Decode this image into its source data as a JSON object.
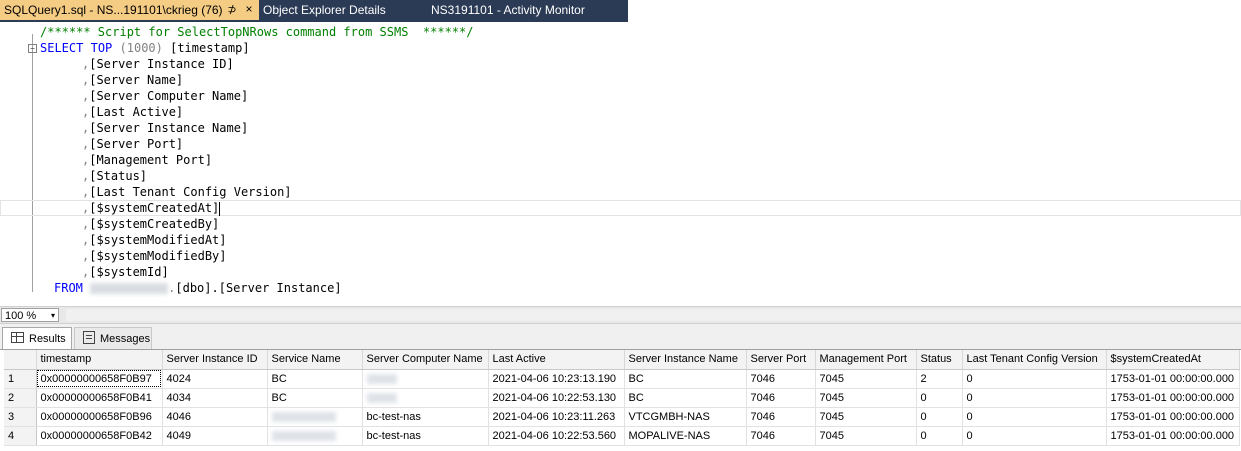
{
  "tabs": [
    {
      "label": "SQLQuery1.sql - NS...191101\\ckrieg (76)",
      "active": true
    },
    {
      "label": "Object Explorer Details",
      "active": false
    },
    {
      "label": "NS3191101 - Activity Monitor",
      "active": false
    }
  ],
  "tab_controls": {
    "pin": "⊅",
    "close": "×"
  },
  "editor": {
    "comment": "/****** Script for SelectTopNRows command from SSMS  ******/",
    "select_kw": "SELECT",
    "top_kw": "TOP",
    "top_value": "(1000)",
    "first_column": "[timestamp]",
    "columns": [
      "[Server Instance ID]",
      "[Server Name]",
      "[Server Computer Name]",
      "[Last Active]",
      "[Server Instance Name]",
      "[Server Port]",
      "[Management Port]",
      "[Status]",
      "[Last Tenant Config Version]",
      "[$systemCreatedAt]",
      "[$systemCreatedBy]",
      "[$systemModifiedAt]",
      "[$systemModifiedBy]",
      "[$systemId]"
    ],
    "comma": ",",
    "from_kw": "FROM",
    "from_dot": ".",
    "from_schema": "[dbo]",
    "from_table": ".[Server Instance]",
    "collapse_glyph": "−"
  },
  "zoom": {
    "value": "100 %",
    "arrow": "▾"
  },
  "result_tabs": {
    "results": "Results",
    "messages": "Messages"
  },
  "grid": {
    "headers": [
      "timestamp",
      "Server Instance ID",
      "Service Name",
      "Server Computer Name",
      "Last Active",
      "Server Instance Name",
      "Server Port",
      "Management Port",
      "Status",
      "Last Tenant Config Version",
      "$systemCreatedAt"
    ],
    "rows": [
      {
        "n": "1",
        "timestamp": "0x00000000658F0B97",
        "sid": "4024",
        "svc": "BC",
        "comp": "",
        "last": "2021-04-06 10:23:13.190",
        "inst": "BC",
        "port": "7046",
        "mport": "7045",
        "status": "2",
        "ltcv": "0",
        "created": "1753-01-01 00:00:00.000"
      },
      {
        "n": "2",
        "timestamp": "0x00000000658F0B41",
        "sid": "4034",
        "svc": "BC",
        "comp": "",
        "last": "2021-04-06 10:22:53.130",
        "inst": "BC",
        "port": "7046",
        "mport": "7045",
        "status": "0",
        "ltcv": "0",
        "created": "1753-01-01 00:00:00.000"
      },
      {
        "n": "3",
        "timestamp": "0x00000000658F0B96",
        "sid": "4046",
        "svc": "",
        "comp": "bc-test-nas",
        "last": "2021-04-06 10:23:11.263",
        "inst": "VTCGMBH-NAS",
        "port": "7046",
        "mport": "7045",
        "status": "0",
        "ltcv": "0",
        "created": "1753-01-01 00:00:00.000"
      },
      {
        "n": "4",
        "timestamp": "0x00000000658F0B42",
        "sid": "4049",
        "svc": "",
        "comp": "bc-test-nas",
        "last": "2021-04-06 10:22:53.560",
        "inst": "MOPALIVE-NAS",
        "port": "7046",
        "mport": "7045",
        "status": "0",
        "ltcv": "0",
        "created": "1753-01-01 00:00:00.000"
      }
    ]
  }
}
